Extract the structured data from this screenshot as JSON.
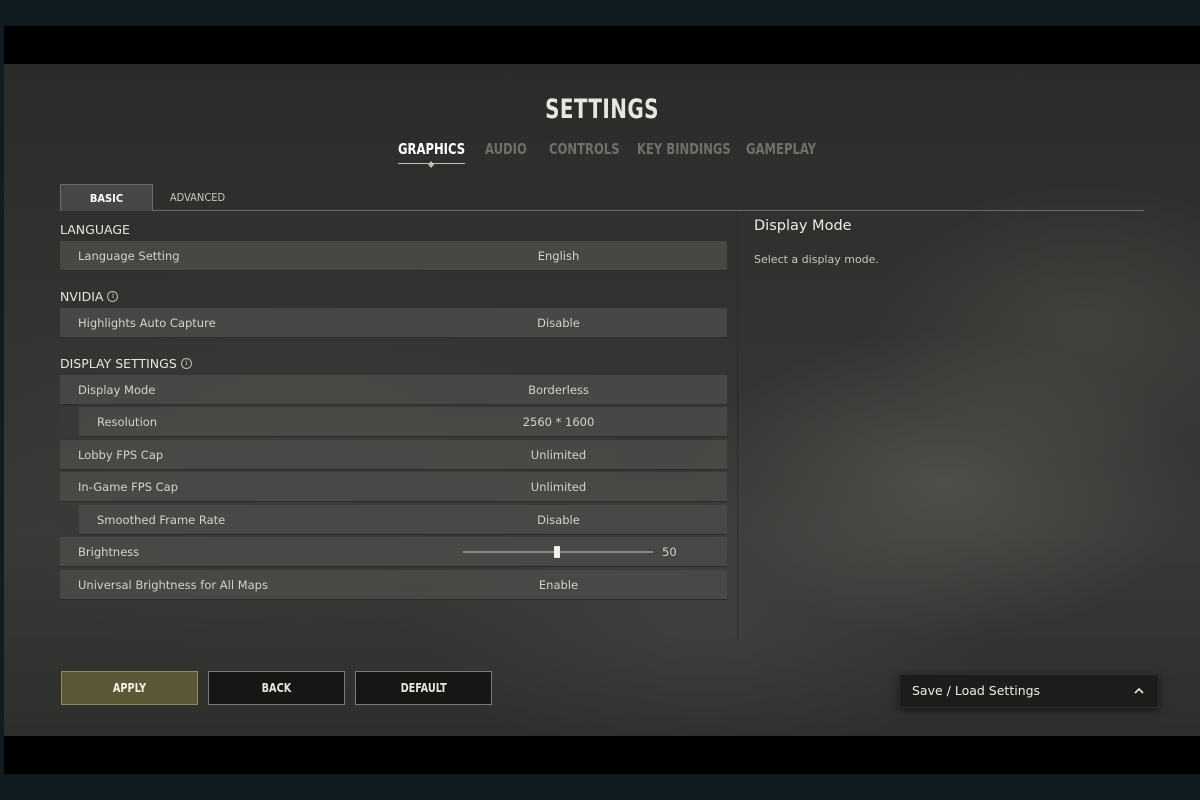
{
  "title": "SETTINGS",
  "main_tabs": [
    {
      "label": "GRAPHICS",
      "active": true
    },
    {
      "label": "AUDIO",
      "active": false
    },
    {
      "label": "CONTROLS",
      "active": false
    },
    {
      "label": "KEY BINDINGS",
      "active": false
    },
    {
      "label": "GAMEPLAY",
      "active": false
    }
  ],
  "sub_tabs": {
    "basic": "BASIC",
    "advanced": "ADVANCED"
  },
  "sections": {
    "language": {
      "title": "LANGUAGE",
      "rows": [
        {
          "label": "Language Setting",
          "value": "English"
        }
      ]
    },
    "nvidia": {
      "title": "NVIDIA",
      "rows": [
        {
          "label": "Highlights Auto Capture",
          "value": "Disable"
        }
      ]
    },
    "display": {
      "title": "DISPLAY SETTINGS",
      "rows": [
        {
          "label": "Display Mode",
          "value": "Borderless"
        },
        {
          "label": "Resolution",
          "value": "2560 * 1600"
        },
        {
          "label": "Lobby FPS Cap",
          "value": "Unlimited"
        },
        {
          "label": "In-Game FPS Cap",
          "value": "Unlimited"
        },
        {
          "label": "Smoothed Frame Rate",
          "value": "Disable"
        },
        {
          "label": "Brightness",
          "value": "50"
        },
        {
          "label": "Universal Brightness for All Maps",
          "value": "Enable"
        }
      ]
    }
  },
  "description": {
    "title": "Display Mode",
    "text": "Select a display mode."
  },
  "buttons": {
    "apply": "APPLY",
    "back": "BACK",
    "default": "DEFAULT"
  },
  "save_load": {
    "label": "Save / Load Settings"
  },
  "colors": {
    "apply_bg": "#5b5838",
    "row_bg": "#4a4a48"
  },
  "icons": {
    "info": "info-icon",
    "chevron": "chevron-up-icon"
  }
}
